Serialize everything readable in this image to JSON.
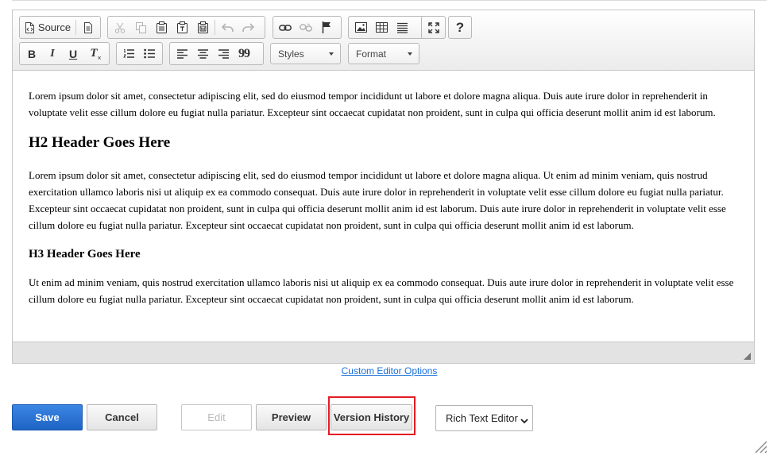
{
  "toolbar": {
    "source_label": "Source",
    "styles_label": "Styles",
    "format_label": "Format",
    "help_glyph": "?",
    "icons": [
      "source-icon",
      "document-icon",
      "cut-icon",
      "copy-icon",
      "paste-icon",
      "paste-text-icon",
      "paste-word-icon",
      "undo-icon",
      "redo-icon",
      "link-icon",
      "unlink-icon",
      "anchor-flag-icon",
      "image-icon",
      "table-icon",
      "horizontal-line-icon",
      "maximize-icon",
      "help-icon",
      "bold-icon",
      "italic-icon",
      "underline-icon",
      "remove-format-icon",
      "numbered-list-icon",
      "bulleted-list-icon",
      "align-left-icon",
      "align-center-icon",
      "align-right-icon",
      "blockquote-icon"
    ],
    "format_buttons": {
      "bold": "B",
      "italic": "I",
      "underline": "U",
      "remove_format": "T",
      "quote": "99"
    }
  },
  "content": {
    "p1": "Lorem ipsum dolor sit amet, consectetur adipiscing elit, sed do eiusmod tempor incididunt ut labore et dolore magna aliqua.  Duis aute irure dolor in reprehenderit in voluptate velit esse cillum dolore eu fugiat nulla pariatur. Excepteur sint occaecat cupidatat non proident, sunt in culpa qui officia deserunt mollit anim id est laborum.",
    "h2": "H2 Header Goes Here",
    "p2": "Lorem ipsum dolor sit amet, consectetur adipiscing elit, sed do eiusmod tempor incididunt ut labore et dolore magna aliqua. Ut enim ad minim veniam, quis nostrud exercitation ullamco laboris nisi ut aliquip ex ea commodo consequat. Duis aute irure dolor in reprehenderit in voluptate velit esse cillum dolore eu fugiat nulla pariatur. Excepteur sint occaecat cupidatat non proident, sunt in culpa qui officia deserunt mollit anim id est laborum. Duis aute irure dolor in reprehenderit in voluptate velit esse cillum dolore eu fugiat nulla pariatur. Excepteur sint occaecat cupidatat non proident, sunt in culpa qui officia deserunt mollit anim id est laborum.",
    "h3": "H3 Header Goes Here",
    "p3": "Ut enim ad minim veniam, quis nostrud exercitation ullamco laboris nisi ut aliquip ex ea commodo consequat. Duis aute irure dolor in reprehenderit in voluptate velit esse cillum dolore eu fugiat nulla pariatur. Excepteur sint occaecat cupidatat non proident, sunt in culpa qui officia deserunt mollit anim id est laborum."
  },
  "custom_editor_options": "Custom Editor Options",
  "actions": {
    "save": "Save",
    "cancel": "Cancel",
    "edit": "Edit",
    "preview": "Preview",
    "version_history": "Version History"
  },
  "editor_mode": {
    "selected": "Rich Text Editor"
  },
  "colors": {
    "primary": "#1e63c4",
    "highlight": "#e51c23",
    "link": "#1a6fd8"
  }
}
